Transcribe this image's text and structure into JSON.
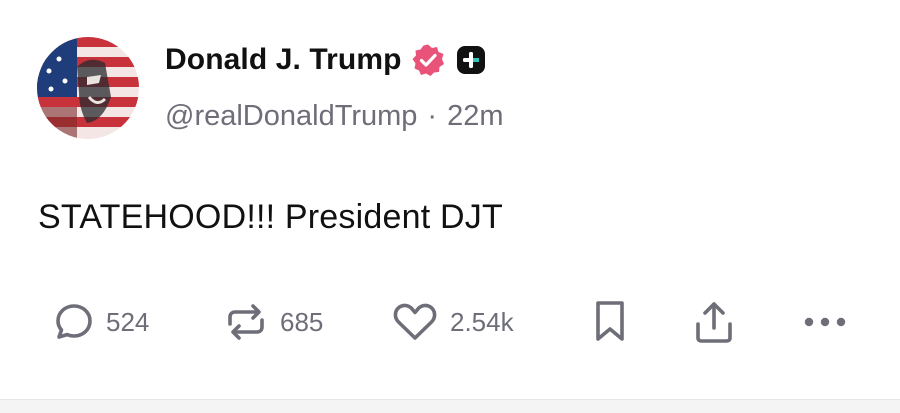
{
  "post": {
    "author": {
      "display_name": "Donald J. Trump",
      "handle": "@realDonaldTrump",
      "verified_badge_icon": "verified-badge-icon",
      "affiliate_badge_icon": "plus-badge-icon",
      "avatar_icon": "avatar-flag-portrait"
    },
    "timestamp_separator": "·",
    "timestamp": "22m",
    "text": "STATEHOOD!!! President DJT"
  },
  "actions": {
    "reply": {
      "icon": "reply-icon",
      "count": "524"
    },
    "repost": {
      "icon": "repost-icon",
      "count": "685"
    },
    "like": {
      "icon": "heart-icon",
      "count": "2.54k"
    },
    "bookmark": {
      "icon": "bookmark-icon"
    },
    "share": {
      "icon": "share-icon"
    },
    "more": {
      "icon": "more-icon"
    }
  },
  "colors": {
    "verified_badge": "#e9537a",
    "muted_text": "#6e6e78",
    "primary_text": "#111111"
  }
}
